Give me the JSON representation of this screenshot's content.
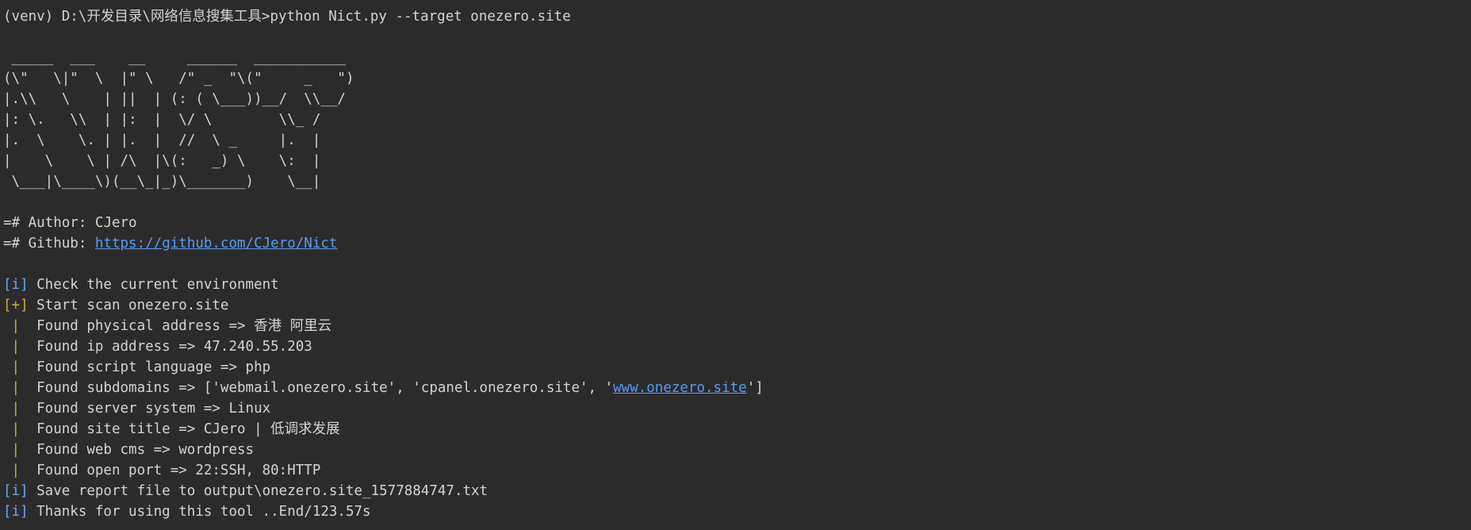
{
  "colors": {
    "background": "#2b2b2b",
    "foreground": "#d4d4d4",
    "link": "#5b9bf0",
    "info_tag": "#6ea4f2",
    "plus_tag": "#c7b530",
    "pipe": "#c7b530"
  },
  "command": {
    "prompt": "(venv) D:\\开发目录\\网络信息搜集工具>",
    "text": "python Nict.py --target onezero.site"
  },
  "banner": " _____  ___    __     ______  ___________\n(\\\"   \\|\"  \\  |\" \\   /\" _  \"\\(\"     _   \")\n|.\\\\   \\    | ||  | (: ( \\___))__/  \\\\__/\n|: \\.   \\\\  | |:  |  \\/ \\        \\\\_ /\n|.  \\    \\. | |.  |  //  \\ _     |.  |\n|    \\    \\ | /\\  |\\(:   _) \\    \\:  |\n \\___|\\____\\)(__\\_|_)\\_______)    \\__|",
  "info": {
    "author_prefix": "=# Author: ",
    "author": "CJero",
    "github_prefix": "=# Github: ",
    "github_url": "https://github.com/CJero/Nict"
  },
  "log": {
    "info_tag": "[i]",
    "plus_tag": "[+]",
    "pipe": " | ",
    "check_env": " Check the current environment",
    "start_scan": " Start scan onezero.site",
    "physical": " Found physical address => 香港 阿里云",
    "ip": " Found ip address => 47.240.55.203",
    "script": " Found script language => php",
    "subdomains_prefix": " Found subdomains => ['webmail.onezero.site', 'cpanel.onezero.site', '",
    "subdomains_link": "www.onezero.site",
    "subdomains_suffix": "']",
    "server": " Found server system => Linux",
    "title": " Found site title => CJero | 低调求发展",
    "cms": " Found web cms => wordpress",
    "ports": " Found open port => 22:SSH, 80:HTTP",
    "save": " Save report file to output\\onezero.site_1577884747.txt",
    "thanks": " Thanks for using this tool ..End/123.57s"
  }
}
